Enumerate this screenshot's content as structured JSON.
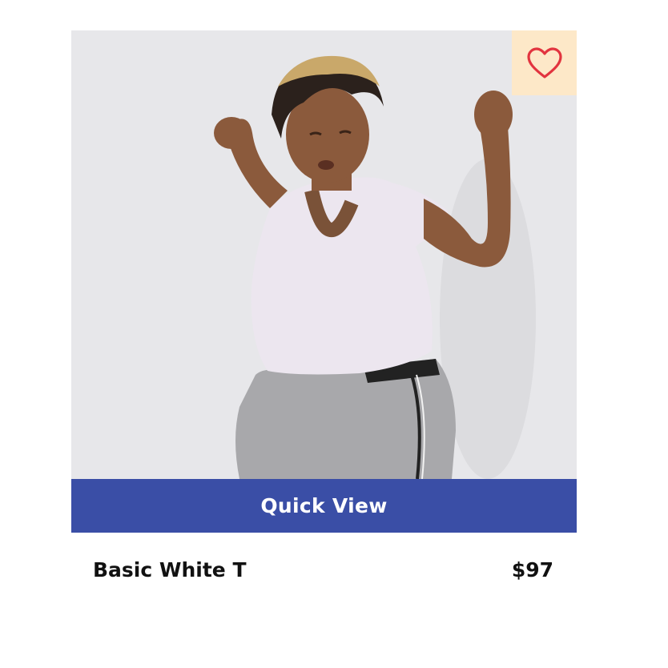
{
  "product": {
    "title": "Basic White T",
    "price": "$97",
    "quick_view_label": "Quick View",
    "wishlist_icon": "heart-outline-icon",
    "image_subject": "product-photo"
  },
  "colors": {
    "accent": "#3a4ea6",
    "heart": "#e2343f",
    "wishlist_bg": "#fde8c8",
    "image_bg": "#e6e6e8"
  }
}
